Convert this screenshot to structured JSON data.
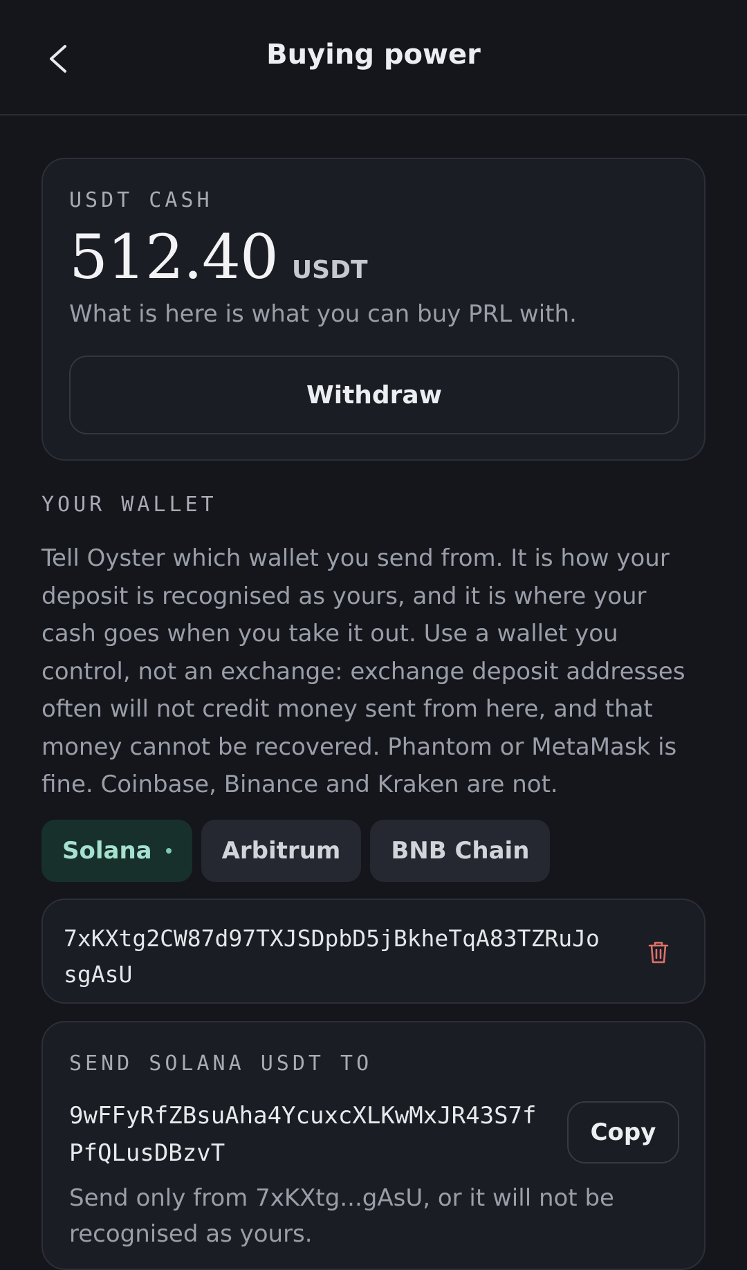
{
  "header": {
    "back_icon": "chevron-left-icon",
    "title": "Buying power"
  },
  "cash": {
    "label": "USDT CASH",
    "amount": "512.40",
    "unit": "USDT",
    "hint": "What is here is what you can buy PRL with.",
    "withdraw_label": "Withdraw"
  },
  "wallet": {
    "label": "YOUR WALLET",
    "description": "Tell Oyster which wallet you send from. It is how your deposit is recognised as yours, and it is where your cash goes when you take it out. Use a wallet you control, not an exchange: exchange deposit addresses often will not credit money sent from here, and that money cannot be recovered. Phantom or MetaMask is fine. Coinbase, Binance and Kraken are not.",
    "chains": [
      {
        "label": "Solana",
        "active": true
      },
      {
        "label": "Arbitrum",
        "active": false
      },
      {
        "label": "BNB Chain",
        "active": false
      }
    ],
    "address": "7xKXtg2CW87d97TXJSDpbD5jBkheTqA83TZRuJosgAsU",
    "delete_icon": "trash-icon"
  },
  "send": {
    "label": "SEND SOLANA USDT TO",
    "address": "9wFFyRfZBsuAha4YcuxcXLKwMxJR43S7fPfQLusDBzvT",
    "copy_label": "Copy",
    "hint": "Send only from 7xKXtg...gAsU, or it will not be recognised as yours."
  },
  "colors": {
    "background": "#14161c",
    "card": "#1a1d24",
    "accent_chip_bg": "#17302b",
    "accent_chip_text": "#a6e1cf",
    "danger": "#e0706a"
  }
}
